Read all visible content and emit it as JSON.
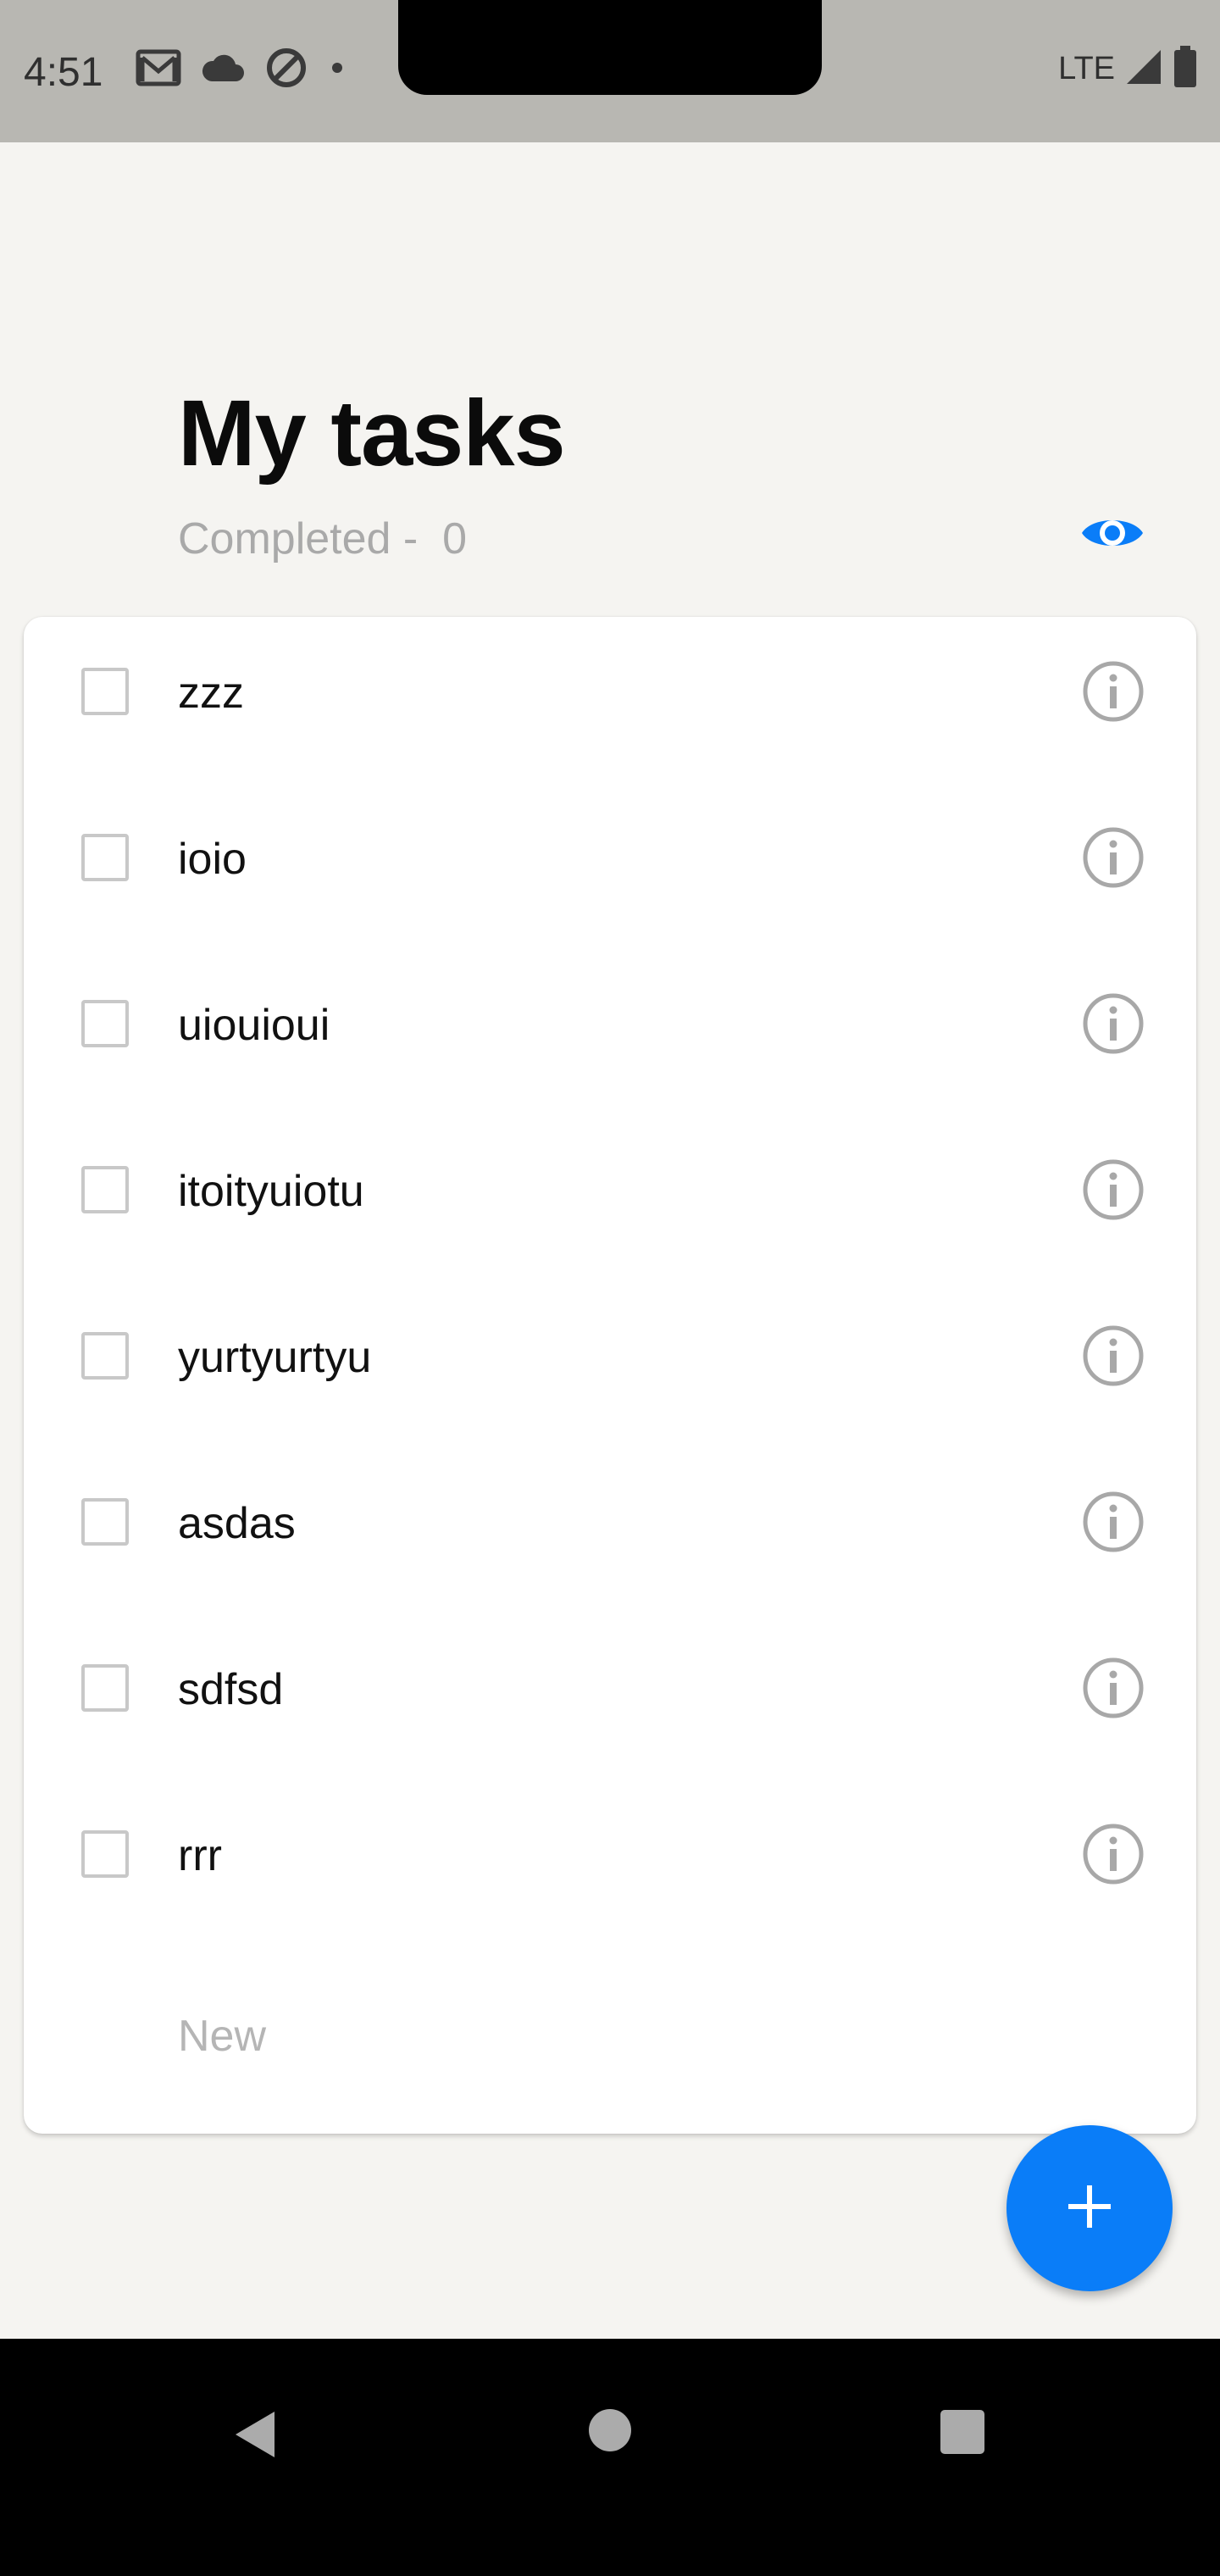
{
  "status_bar": {
    "time": "4:51",
    "network": "LTE",
    "icons_left": [
      "gmail-icon",
      "cloud-icon",
      "data-saver-icon",
      "dot-icon"
    ],
    "icons_right": [
      "signal-icon",
      "battery-icon"
    ]
  },
  "header": {
    "title": "My tasks",
    "completed_label": "Completed -  0",
    "visibility_icon": "eye-icon"
  },
  "tasks": [
    {
      "label": "zzz",
      "checked": false
    },
    {
      "label": "ioio",
      "checked": false
    },
    {
      "label": "uiouioui",
      "checked": false
    },
    {
      "label": "itoityuiotu",
      "checked": false
    },
    {
      "label": "yurtyurtyu",
      "checked": false
    },
    {
      "label": "asdas",
      "checked": false
    },
    {
      "label": "sdfsd",
      "checked": false
    },
    {
      "label": "rrr",
      "checked": false
    }
  ],
  "new_task": {
    "placeholder": "New",
    "value": ""
  },
  "fab": {
    "icon": "plus-icon"
  },
  "nav_bar": {
    "icons": [
      "back-icon",
      "home-icon",
      "recents-icon"
    ]
  },
  "colors": {
    "accent": "#0a7df8",
    "background": "#f5f4f1",
    "status_bar": "#b8b7b2",
    "muted_text": "#a9a9a9",
    "icon_gray": "#a8a8a8"
  }
}
